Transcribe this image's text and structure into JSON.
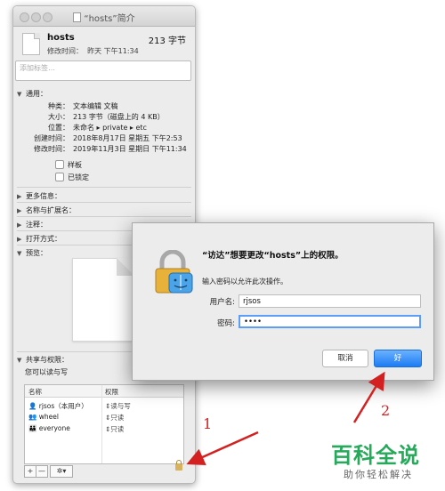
{
  "info_window": {
    "title": "“hosts”简介",
    "file": {
      "name": "hosts",
      "size": "213 字节",
      "modified_label": "修改时间：",
      "modified_value": "昨天 下午11:34"
    },
    "tags_placeholder": "添加标签…",
    "general": {
      "header": "通用：",
      "rows": [
        {
          "key": "种类：",
          "value": "文本编辑 文稿"
        },
        {
          "key": "大小：",
          "value": "213 字节（磁盘上的 4 KB）"
        },
        {
          "key": "位置：",
          "value": "未命名 ▸ private ▸ etc"
        },
        {
          "key": "创建时间：",
          "value": "2018年8月17日 星期五 下午2:53"
        },
        {
          "key": "修改时间：",
          "value": "2019年11月3日 星期日 下午11:34"
        }
      ],
      "checkboxes": [
        "样板",
        "已锁定"
      ]
    },
    "collapsed_sections": [
      "更多信息：",
      "名称与扩展名：",
      "注释：",
      "打开方式："
    ],
    "preview": {
      "header": "预览："
    },
    "sharing": {
      "header": "共享与权限：",
      "subtitle": "您可以读与写",
      "columns": [
        "名称",
        "权限"
      ],
      "rows": [
        {
          "name": "rjsos（本用户）",
          "privilege": "读与写"
        },
        {
          "name": "wheel",
          "privilege": "只读"
        },
        {
          "name": "everyone",
          "privilege": "只读"
        }
      ]
    },
    "toolbar": {
      "add": "+",
      "remove": "—",
      "action": "✲▾"
    }
  },
  "auth_dialog": {
    "title": "“访达”想要更改“hosts”上的权限。",
    "message": "输入密码以允许此次操作。",
    "username_label": "用户名:",
    "username_value": "rjsos",
    "password_label": "密码:",
    "password_value": "••••",
    "cancel_label": "取消",
    "ok_label": "好"
  },
  "annotations": {
    "one": "1",
    "two": "2",
    "color": "#d32020"
  },
  "watermark": {
    "main": "百科全说",
    "sub": "助你轻松解决"
  }
}
